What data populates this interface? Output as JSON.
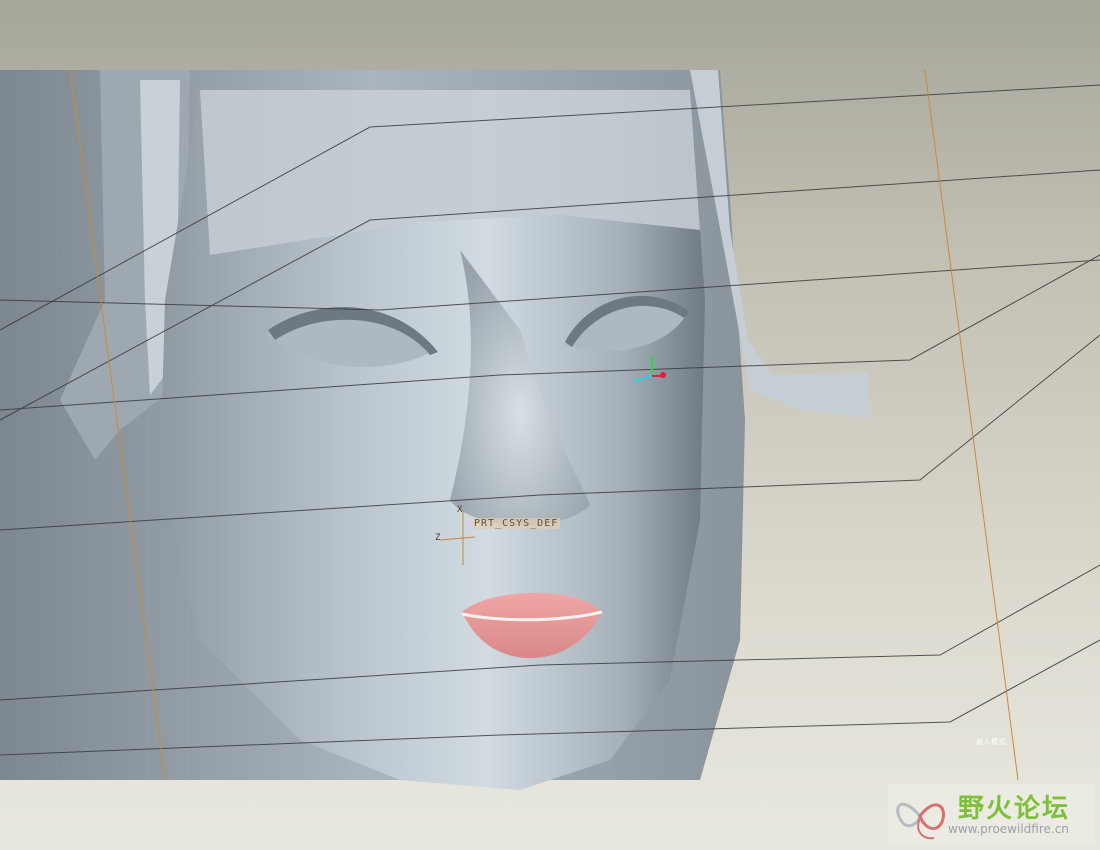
{
  "viewport": {
    "background_color_top": "#a7a69b",
    "background_color_bottom": "#e9e8df",
    "model_surface_color": "#b7c2cb",
    "lip_color": "#e59a9a",
    "datum_line_color": "#3a3a3a",
    "datum_axis_color": "#c98a3a"
  },
  "coordinate_system": {
    "label": "PRT_CSYS_DEF",
    "axis_x_letter": "X",
    "axis_z_letter": "Z"
  },
  "view_triad": {
    "colors": {
      "x": "#e0203a",
      "y": "#2ad84a",
      "z": "#2ad0e0"
    }
  },
  "corner_note": "嵌入模式",
  "watermark": {
    "title": "野火论坛",
    "url": "www.proewildfire.cn",
    "title_color": "#7fbf3a"
  }
}
